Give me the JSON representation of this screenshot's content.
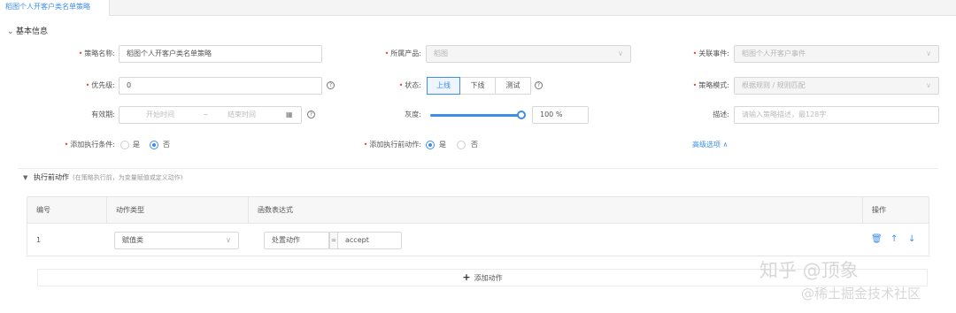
{
  "tab": {
    "title": "稻图个人开客户类名单策略"
  },
  "section": {
    "title": "基本信息"
  },
  "form": {
    "strategy_name": {
      "label": "策略名称:",
      "value": "稻图个人开客户类名单策略"
    },
    "product": {
      "label": "所属产品:",
      "value": "稻图"
    },
    "event": {
      "label": "关联事件:",
      "value": "稻图个人开客户事件"
    },
    "priority": {
      "label": "优先级:",
      "value": "0"
    },
    "status": {
      "label": "状态:",
      "options": [
        "上线",
        "下线",
        "测试"
      ],
      "selected": "上线"
    },
    "mode": {
      "label": "策略模式:",
      "value": "根据规则 / 规则匹配"
    },
    "validity": {
      "label": "有效期:",
      "start_placeholder": "开始时间",
      "separator": "~",
      "end_placeholder": "结束时间"
    },
    "gray": {
      "label": "灰度:",
      "value": "100 %",
      "percent": 100
    },
    "description": {
      "label": "描述:",
      "placeholder": "请输入策略描述，最128字"
    },
    "add_condition": {
      "label": "添加执行条件:",
      "yes": "是",
      "no": "否",
      "selected": "否"
    },
    "add_pre_action": {
      "label": "添加执行前动作:",
      "yes": "是",
      "no": "否",
      "selected": "是"
    },
    "advanced_link": "高级选项"
  },
  "pre_action": {
    "title": "执行前动作",
    "note": "(在策略执行前，为变量赋值或定义动作)",
    "columns": [
      "编号",
      "动作类型",
      "函数表达式",
      "操作"
    ],
    "rows": [
      {
        "no": "1",
        "type": "赋值类",
        "expr_left": "处置动作",
        "eq": "=",
        "expr_right": "accept"
      }
    ],
    "add_label": "添加动作"
  },
  "watermark": {
    "line1": "知乎 @顶象",
    "line2": "@稀土掘金技术社区"
  },
  "colors": {
    "accent": "#3c8ee8",
    "required": "#e0452f"
  }
}
